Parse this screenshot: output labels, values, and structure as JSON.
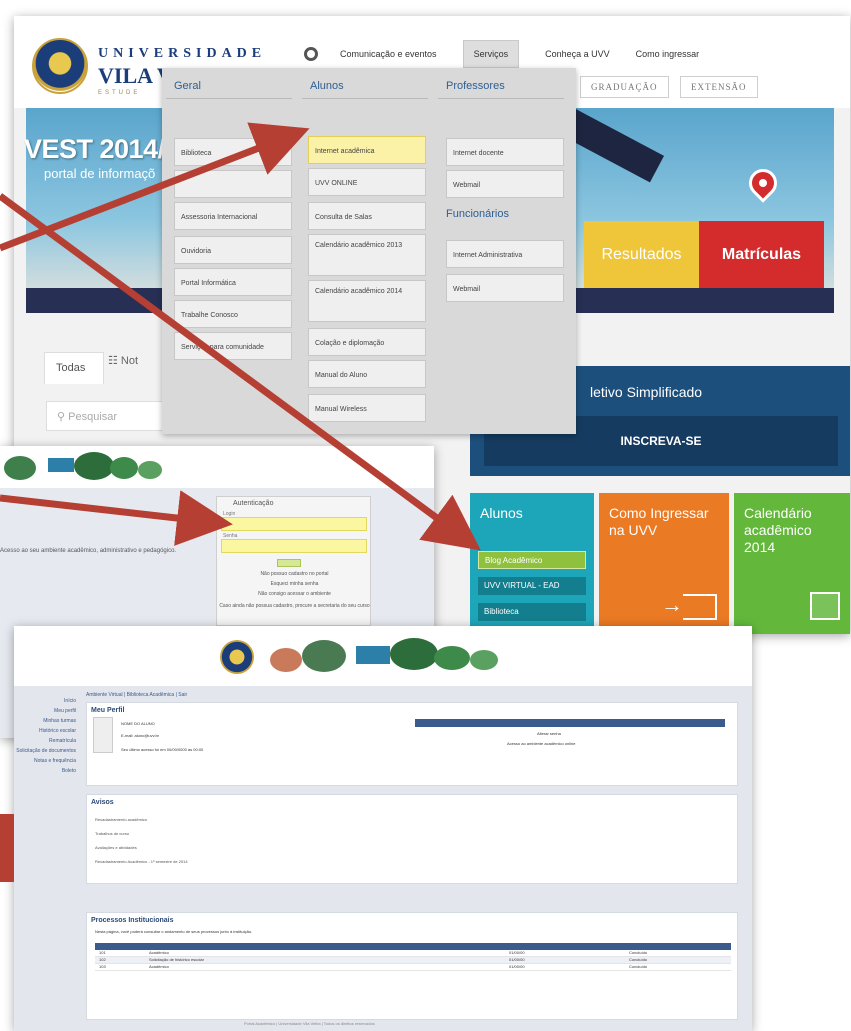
{
  "portal": {
    "logo": {
      "line1": "UNIVERSIDADE",
      "line2": "VILA V",
      "line3": "ESTUDE"
    },
    "topnav": [
      {
        "label": "Comunicação e eventos",
        "active": false
      },
      {
        "label": "Serviços",
        "active": true
      },
      {
        "label": "Conheça a UVV",
        "active": false
      },
      {
        "label": "Como ingressar",
        "active": false
      }
    ],
    "nav_buttons": [
      {
        "label": "GRADUAÇÃO"
      },
      {
        "label": "EXTENSÃO"
      }
    ],
    "banner": {
      "vest": "VEST 2014/",
      "sub": "portal de informaçõ",
      "results": "Resultados",
      "matriculas": "Matrículas"
    },
    "tabs": {
      "todas": "Todas",
      "not": "Not"
    },
    "search": {
      "placeholder": "Pesquisar"
    },
    "seletivo": {
      "title": "letivo Simplificado",
      "button": "INSCREVA-SE"
    },
    "tiles": {
      "alunos": {
        "title": "Alunos",
        "buttons": [
          "Blog Acadêmico",
          "UVV VIRTUAL - EAD",
          "Biblioteca"
        ]
      },
      "como": {
        "title": "Como Ingressar na UVV"
      },
      "calendario": {
        "title": "Calendário acadêmico 2014"
      }
    }
  },
  "mega_menu": {
    "geral": {
      "heading": "Geral",
      "items": [
        "Biblioteca",
        "",
        "Assessoria Internacional",
        "Ouvidoria",
        "Portal Informática",
        "Trabalhe Conosco",
        "Serviços para comunidade"
      ]
    },
    "alunos": {
      "heading": "Alunos",
      "items": [
        "Internet acadêmica",
        "UVV ONLINE",
        "Consulta de Salas",
        "Calendário acadêmico 2013",
        "Calendário acadêmico 2014",
        "Colação e diplomação",
        "Manual do Aluno",
        "Manual Wireless"
      ]
    },
    "professores": {
      "heading": "Professores",
      "items": [
        "Internet docente",
        "Webmail"
      ]
    },
    "funcionarios": {
      "heading": "Funcionários",
      "items": [
        "Internet Administrativa",
        "Webmail"
      ]
    }
  },
  "login": {
    "intro": "Acesso ao seu ambiente acadêmico, administrativo e pedagógico.",
    "box_title": "Autenticação",
    "user_label": "Login",
    "pass_label": "Senha",
    "links": [
      "Não possuo cadastro no portal",
      "Esqueci minha senha",
      "Não consigo acessar o ambiente",
      "Caso ainda não possua cadastro, procure a secretaria do seu curso"
    ]
  },
  "profile": {
    "sidebar": [
      "Início",
      "Meu perfil",
      "Minhas turmas",
      "Histórico escolar",
      "Rematrícula",
      "Solicitação de documentos",
      "Notas e frequência",
      "Boleto"
    ],
    "toolbar": "Ambiente Virtual | Biblioteca Acadêmica | Sair",
    "title": "Meu Perfil",
    "info_lines": [
      "NOME DO ALUNO",
      "E-mail: aluno@uvv.br",
      "Seu último acesso foi em 00/00/0000 às 00:00"
    ],
    "quick_links": [
      "Alterar senha",
      "Acesso ao ambiente acadêmico online"
    ],
    "avisos": {
      "title": "Avisos",
      "rows": [
        "Recadastramento acadêmico",
        "Trabalhos de curso",
        "Avaliações e atividades",
        "Recadastramento Acadêmico - 1º semestre de 2014"
      ]
    },
    "processos": {
      "title": "Processos Institucionais",
      "desc": "Nesta página, você poderá consultar o andamento de seus processos junto à instituição.",
      "rows": [
        [
          "101",
          "Acadêmico",
          "01/00/00",
          "Concluído"
        ],
        [
          "102",
          "Solicitação de histórico escolar",
          "01/00/00",
          "Concluído"
        ],
        [
          "103",
          "Acadêmico",
          "01/00/00",
          "Concluído"
        ]
      ]
    },
    "footer": "Portal Acadêmico | Universidade Vila Velha | Todos os direitos reservados"
  },
  "colors": {
    "arrow": "#b63f33",
    "portal_blue": "#1c4f7c",
    "alunos_tile": "#1da6b9",
    "como_tile": "#ea7a24",
    "cal_tile": "#63b83c",
    "matriculas": "#d42c2c",
    "resultados": "#efc53a"
  }
}
